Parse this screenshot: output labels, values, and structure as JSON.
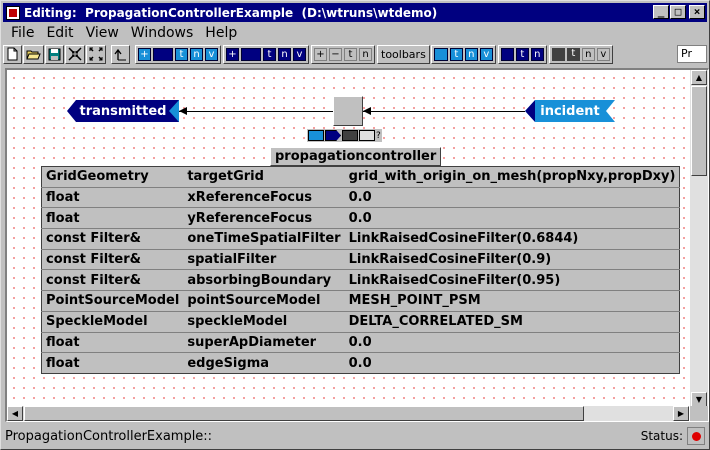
{
  "window": {
    "title": "Editing:  PropagationControllerExample  (D:\\wtruns\\wtdemo)",
    "buttons": {
      "minimize": "_",
      "maximize": "□",
      "close": "×"
    }
  },
  "menubar": {
    "items": [
      "File",
      "Edit",
      "View",
      "Windows",
      "Help"
    ]
  },
  "toolbar": {
    "group1_labels": [
      "t",
      "n",
      "v"
    ],
    "group2_labels": [
      "t",
      "n",
      "v"
    ],
    "small_text": [
      "t",
      "n"
    ],
    "toolbars_label": "toolbars",
    "group3_labels": [
      "t",
      "n",
      "v"
    ],
    "group4_labels": [
      "t",
      "n"
    ],
    "group5_labels": [
      "t",
      "n",
      "v"
    ],
    "path_field": "Pr"
  },
  "diagram": {
    "ports": {
      "left_label": "transmitted",
      "right_label": "incident"
    },
    "node": {
      "title": "propagationcontroller",
      "help_glyph": "?",
      "params": [
        {
          "type": "GridGeometry",
          "name": "targetGrid",
          "value": "grid_with_origin_on_mesh(propNxy,propDxy)"
        },
        {
          "type": "float",
          "name": "xReferenceFocus",
          "value": "0.0"
        },
        {
          "type": "float",
          "name": "yReferenceFocus",
          "value": "0.0"
        },
        {
          "type": "const Filter&",
          "name": "oneTimeSpatialFilter",
          "value": "LinkRaisedCosineFilter(0.6844)"
        },
        {
          "type": "const Filter&",
          "name": "spatialFilter",
          "value": "LinkRaisedCosineFilter(0.9)"
        },
        {
          "type": "const Filter&",
          "name": "absorbingBoundary",
          "value": "LinkRaisedCosineFilter(0.95)"
        },
        {
          "type": "PointSourceModel",
          "name": "pointSourceModel",
          "value": "MESH_POINT_PSM"
        },
        {
          "type": "SpeckleModel",
          "name": "speckleModel",
          "value": "DELTA_CORRELATED_SM"
        },
        {
          "type": "float",
          "name": "superApDiameter",
          "value": "0.0"
        },
        {
          "type": "float",
          "name": "edgeSigma",
          "value": "0.0"
        }
      ]
    }
  },
  "statusbar": {
    "text": "PropagationControllerExample::",
    "status_label": "Status:",
    "status_color": "#e00000"
  }
}
